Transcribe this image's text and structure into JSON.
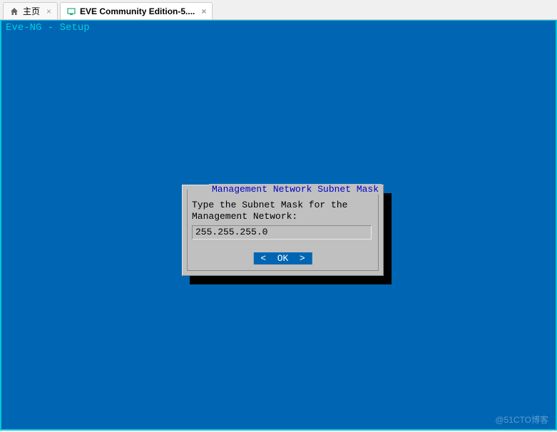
{
  "tabs": {
    "home": {
      "label": "主页"
    },
    "active": {
      "label": "EVE Community Edition-5...."
    }
  },
  "terminal": {
    "title": "Eve-NG - Setup"
  },
  "dialog": {
    "title": "Management Network Subnet Mask",
    "text": "Type the Subnet Mask for the\nManagement Network:",
    "input_value": "255.255.255.0",
    "ok_label": "<  OK  >"
  },
  "watermark": "@51CTO博客"
}
